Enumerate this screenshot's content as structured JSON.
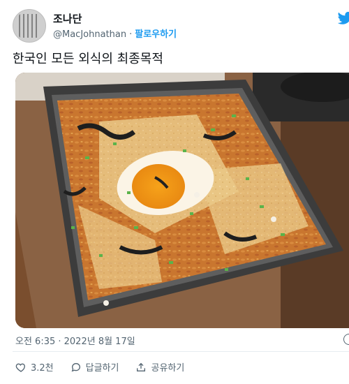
{
  "author": {
    "display_name": "조나단",
    "handle": "@MacJohnathan",
    "separator": "·",
    "follow_label": "팔로우하기"
  },
  "tweet": {
    "text": "한국인 모든 외식의 최종목적",
    "timestamp": "오전 6:35 · 2022년 8월 17일"
  },
  "actions": {
    "like_count": "3.2천",
    "reply_label": "답글하기",
    "share_label": "공유하기"
  },
  "colors": {
    "accent": "#1d9bf0",
    "secondary_text": "#536471"
  }
}
